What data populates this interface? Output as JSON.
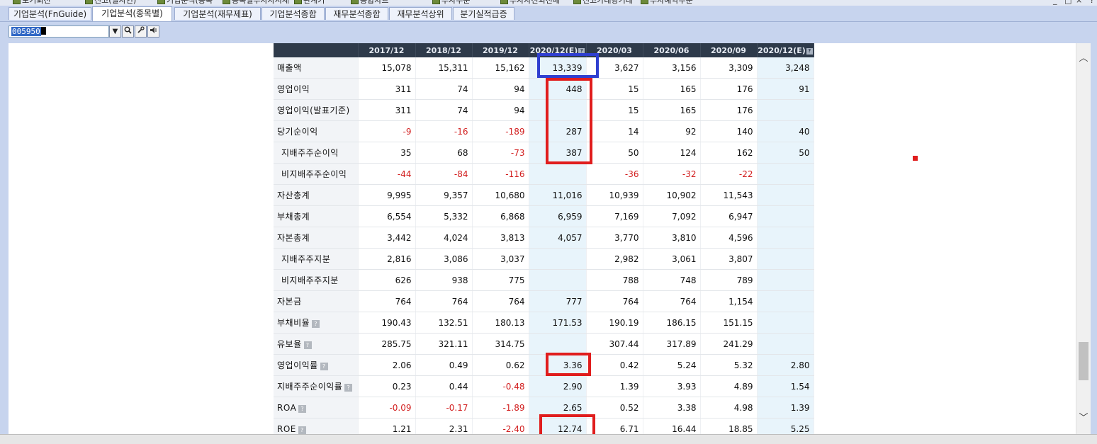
{
  "window_tabs": [
    {
      "label": "포기회전"
    },
    {
      "label": "신고(일자인)"
    },
    {
      "label": "기업분석(종목"
    },
    {
      "label": "종목별투자자시세"
    },
    {
      "label": "관계기"
    },
    {
      "label": "종합차트"
    },
    {
      "label": "투자주문"
    },
    {
      "label": "투자자전외전매"
    },
    {
      "label": "신고가대량거래"
    },
    {
      "label": "투자예약주문"
    }
  ],
  "window_controls": {
    "minimize": "_",
    "maximize": "□",
    "close": "×",
    "help": "?"
  },
  "tabs": [
    {
      "label": "기업분석(FnGuide)",
      "active": false
    },
    {
      "label": "기업분석(종목별)",
      "active": true
    },
    {
      "label": "기업분석(재무제표)",
      "active": false
    },
    {
      "label": "기업분석종합",
      "active": false
    },
    {
      "label": "재무분석종합",
      "active": false
    },
    {
      "label": "재무분석상위",
      "active": false
    },
    {
      "label": "분기실적급증",
      "active": false
    }
  ],
  "toolbar": {
    "stock_code": "005950",
    "dropdown_glyph": "▼",
    "search_glyph": "🔍",
    "tools_glyph": "🔧",
    "speaker_glyph": "🔈"
  },
  "scrollbar": {
    "up": "︿",
    "down": "﹀"
  },
  "table": {
    "headers": [
      "2017/12",
      "2018/12",
      "2019/12",
      "2020/12(E)",
      "2020/03",
      "2020/06",
      "2020/09",
      "2020/12(E)"
    ],
    "header_help": [
      false,
      false,
      false,
      true,
      false,
      false,
      false,
      true
    ],
    "estimate_columns": [
      3,
      7
    ],
    "rows": [
      {
        "label": "매출액",
        "sub": false,
        "help": false,
        "values": [
          "15,078",
          "15,311",
          "15,162",
          "13,339",
          "3,627",
          "3,156",
          "3,309",
          "3,248"
        ]
      },
      {
        "label": "영업이익",
        "sub": false,
        "help": false,
        "values": [
          "311",
          "74",
          "94",
          "448",
          "15",
          "165",
          "176",
          "91"
        ]
      },
      {
        "label": "영업이익(발표기준)",
        "sub": false,
        "help": false,
        "values": [
          "311",
          "74",
          "94",
          "",
          "15",
          "165",
          "176",
          ""
        ]
      },
      {
        "label": "당기순이익",
        "sub": false,
        "help": false,
        "values": [
          "-9",
          "-16",
          "-189",
          "287",
          "14",
          "92",
          "140",
          "40"
        ]
      },
      {
        "label": "지배주주순이익",
        "sub": true,
        "help": false,
        "values": [
          "35",
          "68",
          "-73",
          "387",
          "50",
          "124",
          "162",
          "50"
        ]
      },
      {
        "label": "비지배주주순이익",
        "sub": true,
        "help": false,
        "values": [
          "-44",
          "-84",
          "-116",
          "",
          "-36",
          "-32",
          "-22",
          ""
        ]
      },
      {
        "label": "자산총계",
        "sub": false,
        "help": false,
        "values": [
          "9,995",
          "9,357",
          "10,680",
          "11,016",
          "10,939",
          "10,902",
          "11,543",
          ""
        ]
      },
      {
        "label": "부채총계",
        "sub": false,
        "help": false,
        "values": [
          "6,554",
          "5,332",
          "6,868",
          "6,959",
          "7,169",
          "7,092",
          "6,947",
          ""
        ]
      },
      {
        "label": "자본총계",
        "sub": false,
        "help": false,
        "values": [
          "3,442",
          "4,024",
          "3,813",
          "4,057",
          "3,770",
          "3,810",
          "4,596",
          ""
        ]
      },
      {
        "label": "지배주주지분",
        "sub": true,
        "help": false,
        "values": [
          "2,816",
          "3,086",
          "3,037",
          "",
          "2,982",
          "3,061",
          "3,807",
          ""
        ]
      },
      {
        "label": "비지배주주지분",
        "sub": true,
        "help": false,
        "values": [
          "626",
          "938",
          "775",
          "",
          "788",
          "748",
          "789",
          ""
        ]
      },
      {
        "label": "자본금",
        "sub": false,
        "help": false,
        "values": [
          "764",
          "764",
          "764",
          "777",
          "764",
          "764",
          "1,154",
          ""
        ]
      },
      {
        "label": "부채비율",
        "sub": false,
        "help": true,
        "values": [
          "190.43",
          "132.51",
          "180.13",
          "171.53",
          "190.19",
          "186.15",
          "151.15",
          ""
        ]
      },
      {
        "label": "유보율",
        "sub": false,
        "help": true,
        "values": [
          "285.75",
          "321.11",
          "314.75",
          "",
          "307.44",
          "317.89",
          "241.29",
          ""
        ]
      },
      {
        "label": "영업이익률",
        "sub": false,
        "help": true,
        "values": [
          "2.06",
          "0.49",
          "0.62",
          "3.36",
          "0.42",
          "5.24",
          "5.32",
          "2.80"
        ]
      },
      {
        "label": "지배주주순이익률",
        "sub": false,
        "help": true,
        "values": [
          "0.23",
          "0.44",
          "-0.48",
          "2.90",
          "1.39",
          "3.93",
          "4.89",
          "1.54"
        ]
      },
      {
        "label": "ROA",
        "sub": false,
        "help": true,
        "values": [
          "-0.09",
          "-0.17",
          "-1.89",
          "2.65",
          "0.52",
          "3.38",
          "4.98",
          "1.39"
        ]
      },
      {
        "label": "ROE",
        "sub": false,
        "help": true,
        "values": [
          "1.21",
          "2.31",
          "-2.40",
          "12.74",
          "6.71",
          "16.44",
          "18.85",
          "5.25"
        ]
      }
    ]
  },
  "colors": {
    "negative": "#d21f1f",
    "header_bg": "#2e3a4a",
    "estimate_bg": "#e8f4fb",
    "annotation_red": "#e01d1d",
    "annotation_blue": "#2f3fd0"
  }
}
